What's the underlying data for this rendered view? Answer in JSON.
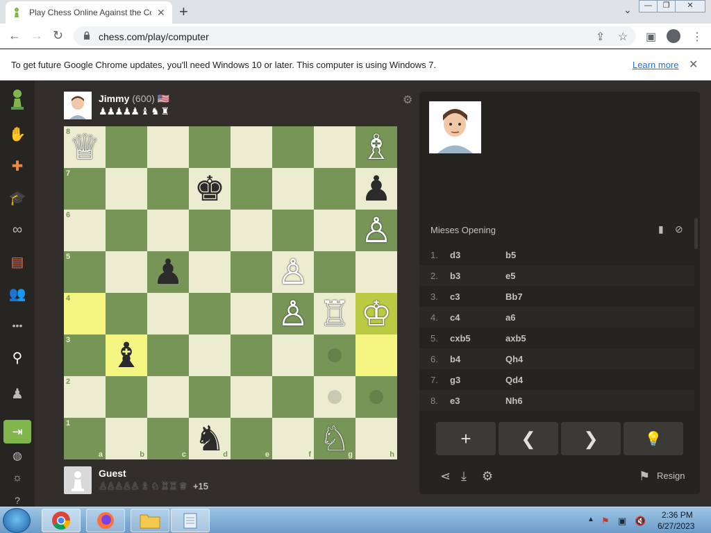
{
  "browser": {
    "tab_title": "Play Chess Online Against the Cc",
    "tab_close": "✕",
    "new_tab": "+",
    "url": "chess.com/play/computer",
    "window_controls": [
      "—",
      "❐",
      "✕"
    ]
  },
  "infobar": {
    "message": "To get future Google Chrome updates, you'll need Windows 10 or later. This computer is using Windows 7.",
    "link": "Learn more",
    "close": "✕"
  },
  "site_sidebar": {
    "items": [
      "pawn-logo",
      "play",
      "puzzles",
      "learn",
      "watch",
      "news",
      "social",
      "more",
      "search",
      "profile-add",
      "signup",
      "language",
      "theme",
      "help"
    ],
    "more_label": "•••"
  },
  "top_player": {
    "name": "Jimmy",
    "rating": "(600)",
    "flag": "🇺🇸",
    "captured": "♟♟♟♟♟ ♝ ♞ ♜"
  },
  "bottom_player": {
    "name": "Guest",
    "captured": "♙♙♙♙♙ ♗ ♘ ♖♖ ♕",
    "score": "+15"
  },
  "board": {
    "files": [
      "a",
      "b",
      "c",
      "d",
      "e",
      "f",
      "g",
      "h"
    ],
    "ranks": [
      "8",
      "7",
      "6",
      "5",
      "4",
      "3",
      "2",
      "1"
    ],
    "highlighted": [
      "a4",
      "b3",
      "h3",
      "h4"
    ],
    "hints": [
      "g3",
      "g2",
      "h2"
    ],
    "pieces": [
      {
        "square": "a8",
        "glyph": "♕",
        "color": "white"
      },
      {
        "square": "h8",
        "glyph": "♗",
        "color": "white"
      },
      {
        "square": "d7",
        "glyph": "♚",
        "color": "black"
      },
      {
        "square": "h7",
        "glyph": "♟",
        "color": "black"
      },
      {
        "square": "h6",
        "glyph": "♙",
        "color": "white"
      },
      {
        "square": "c5",
        "glyph": "♟",
        "color": "black"
      },
      {
        "square": "f5",
        "glyph": "♙",
        "color": "white"
      },
      {
        "square": "f4",
        "glyph": "♙",
        "color": "white"
      },
      {
        "square": "g4",
        "glyph": "♖",
        "color": "white"
      },
      {
        "square": "h4",
        "glyph": "♔",
        "color": "white"
      },
      {
        "square": "b3",
        "glyph": "♝",
        "color": "black"
      },
      {
        "square": "d1",
        "glyph": "♞",
        "color": "black"
      },
      {
        "square": "g1",
        "glyph": "♘",
        "color": "white"
      }
    ],
    "colors": {
      "light": "#ebecd0",
      "dark": "#779556",
      "highlight_light": "#f5f682",
      "highlight_dark": "#b9ca43"
    }
  },
  "side_panel": {
    "opening": "Mieses Opening",
    "moves": [
      {
        "n": "1.",
        "w": "d3",
        "b": "b5"
      },
      {
        "n": "2.",
        "w": "b3",
        "b": "e5"
      },
      {
        "n": "3.",
        "w": "c3",
        "b": "Bb7"
      },
      {
        "n": "4.",
        "w": "c4",
        "b": "a6"
      },
      {
        "n": "5.",
        "w": "cxb5",
        "b": "axb5"
      },
      {
        "n": "6.",
        "w": "b4",
        "b": "Qh4"
      },
      {
        "n": "7.",
        "w": "g3",
        "b": "Qd4"
      },
      {
        "n": "8.",
        "w": "e3",
        "b": "Nh6"
      }
    ],
    "controls": [
      "+",
      "❮",
      "❯",
      "💡"
    ],
    "resign": "Resign"
  },
  "taskbar": {
    "time": "2:36 PM",
    "date": "6/27/2023"
  }
}
